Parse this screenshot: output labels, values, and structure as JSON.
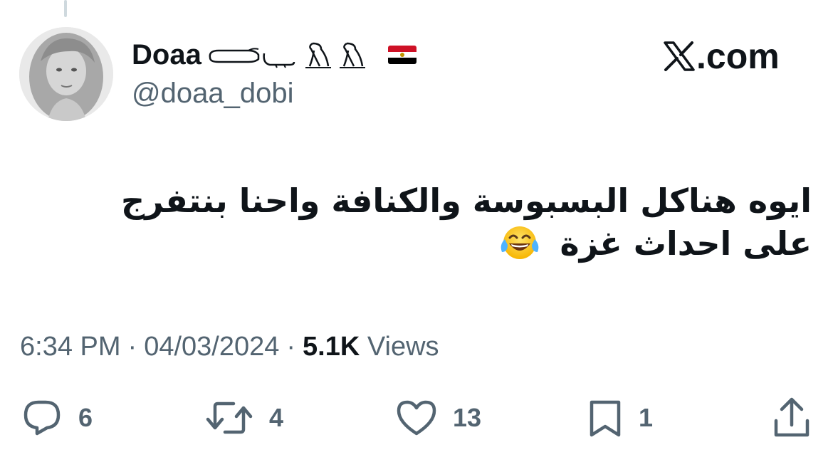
{
  "author": {
    "display_name": "Doaa",
    "handle": "@doaa_dobi",
    "flag": "egypt-flag",
    "name_decoration": "egyptian-hieroglyphs"
  },
  "brand": {
    "logo": "x-logo-icon",
    "text": ".com"
  },
  "tweet": {
    "text": "ايوه هناكل البسبوسة والكنافة واحنا بنتفرج على احداث غزة",
    "emoji": "face-with-tears-of-joy"
  },
  "meta": {
    "time": "6:34 PM",
    "separator": "·",
    "date": "04/03/2024",
    "views_count": "5.1K",
    "views_label": "Views"
  },
  "actions": {
    "reply_count": "6",
    "retweet_count": "4",
    "like_count": "13",
    "bookmark_count": "1"
  },
  "colors": {
    "text_primary": "#0f1419",
    "text_secondary": "#536471",
    "background": "#ffffff"
  }
}
